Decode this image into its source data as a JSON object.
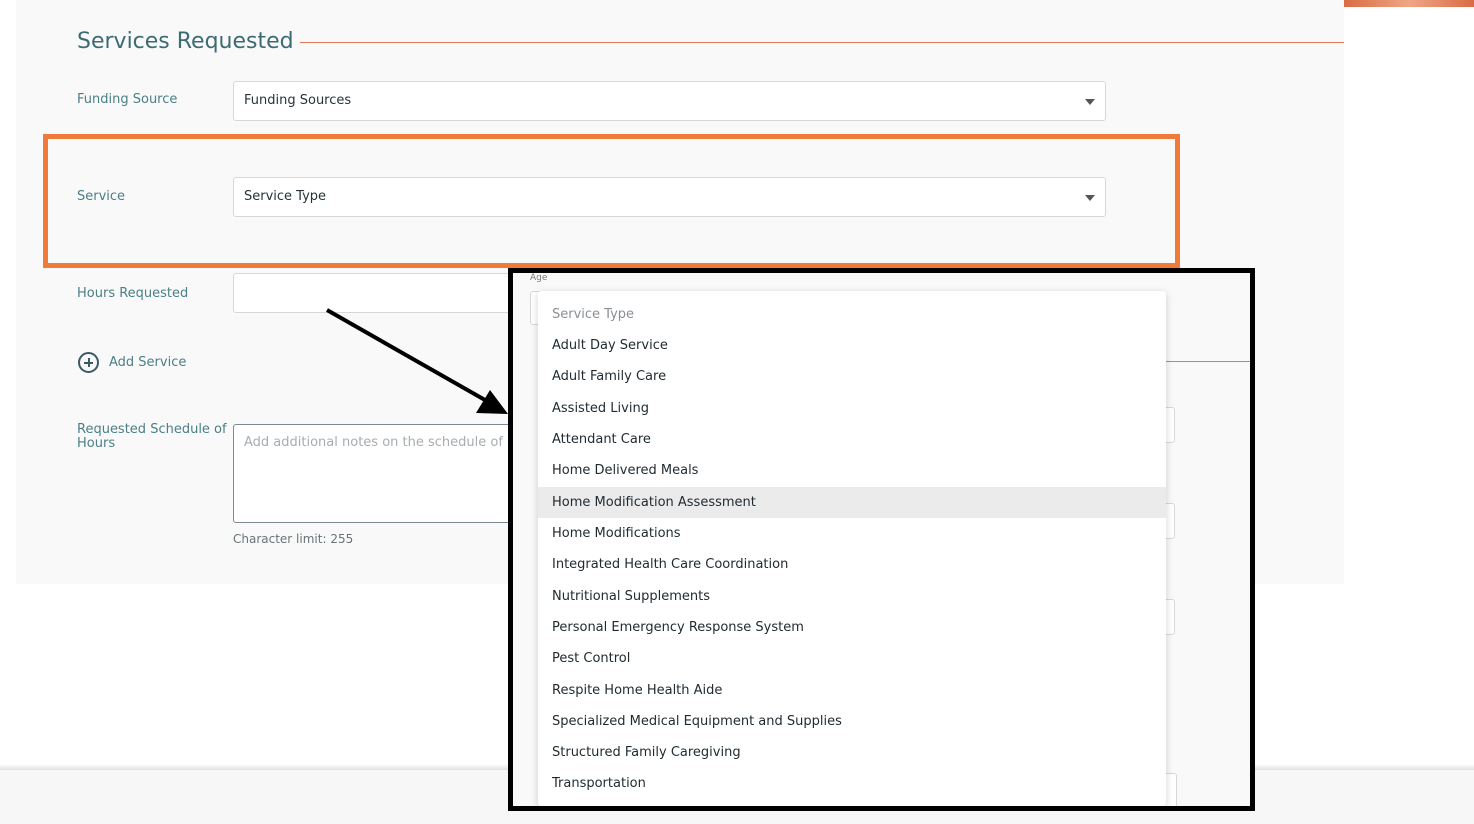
{
  "section": {
    "title": "Services Requested"
  },
  "funding_source": {
    "label": "Funding Source",
    "value": "Funding Sources"
  },
  "service": {
    "label": "Service",
    "value": "Service Type"
  },
  "hours_requested": {
    "label": "Hours Requested"
  },
  "add_service": {
    "label": "Add Service"
  },
  "schedule": {
    "label": "Requested Schedule of Hours",
    "placeholder": "Add additional notes on the schedule of h",
    "hint": "Character limit: 255"
  },
  "inset": {
    "ghost_age_label": "Age",
    "dropdown": {
      "placeholder": "Service Type",
      "hovered_item": "Home Modification Assessment",
      "items": [
        "Adult Day Service",
        "Adult Family Care",
        "Assisted Living",
        "Attendant Care",
        "Home Delivered Meals",
        "Home Modification Assessment",
        "Home Modifications",
        "Integrated Health Care Coordination",
        "Nutritional Supplements",
        "Personal Emergency Response System",
        "Pest Control",
        "Respite Home Health Aide",
        "Specialized Medical Equipment and Supplies",
        "Structured Family Caregiving",
        "Transportation"
      ]
    }
  },
  "colors": {
    "accent": "#f07a3a",
    "label_teal": "#4a7f87",
    "rule": "#e07b55"
  }
}
